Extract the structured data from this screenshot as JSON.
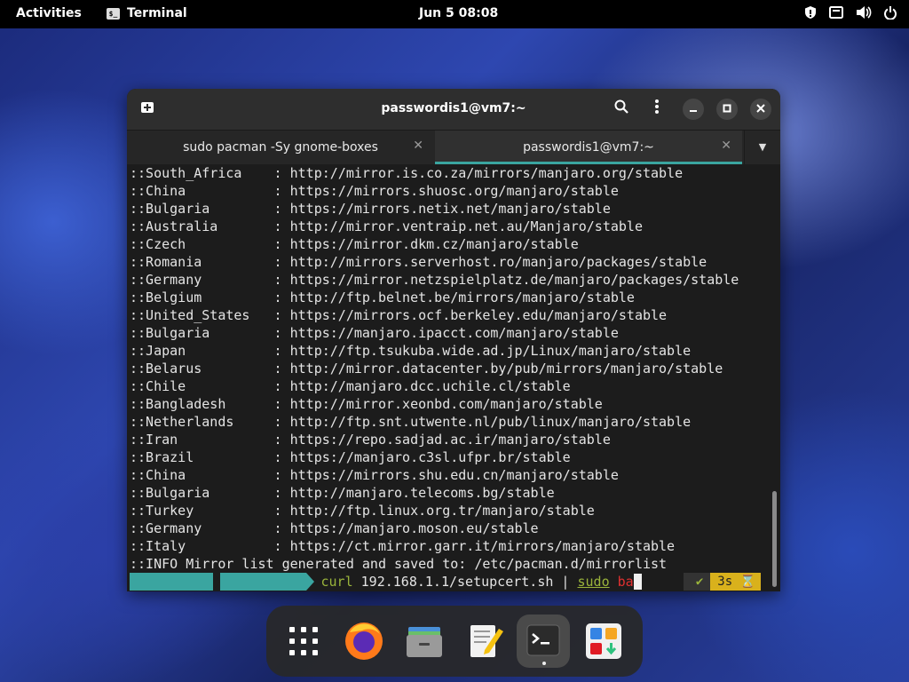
{
  "topbar": {
    "activities": "Activities",
    "app_name": "Terminal",
    "clock": "Jun 5  08:08"
  },
  "window": {
    "title": "passwordis1@vm7:~",
    "tabs": [
      {
        "label": "sudo pacman -Sy gnome-boxes"
      },
      {
        "label": "passwordis1@vm7:~"
      }
    ]
  },
  "terminal": {
    "lines": [
      "::South_Africa    : http://mirror.is.co.za/mirrors/manjaro.org/stable",
      "::China           : https://mirrors.shuosc.org/manjaro/stable",
      "::Bulgaria        : https://mirrors.netix.net/manjaro/stable",
      "::Australia       : http://mirror.ventraip.net.au/Manjaro/stable",
      "::Czech           : https://mirror.dkm.cz/manjaro/stable",
      "::Romania         : http://mirrors.serverhost.ro/manjaro/packages/stable",
      "::Germany         : https://mirror.netzspielplatz.de/manjaro/packages/stable",
      "::Belgium         : http://ftp.belnet.be/mirrors/manjaro/stable",
      "::United_States   : https://mirrors.ocf.berkeley.edu/manjaro/stable",
      "::Bulgaria        : https://manjaro.ipacct.com/manjaro/stable",
      "::Japan           : http://ftp.tsukuba.wide.ad.jp/Linux/manjaro/stable",
      "::Belarus         : http://mirror.datacenter.by/pub/mirrors/manjaro/stable",
      "::Chile           : http://manjaro.dcc.uchile.cl/stable",
      "::Bangladesh      : http://mirror.xeonbd.com/manjaro/stable",
      "::Netherlands     : http://ftp.snt.utwente.nl/pub/linux/manjaro/stable",
      "::Iran            : https://repo.sadjad.ac.ir/manjaro/stable",
      "::Brazil          : https://manjaro.c3sl.ufpr.br/stable",
      "::China           : https://mirrors.shu.edu.cn/manjaro/stable",
      "::Bulgaria        : http://manjaro.telecoms.bg/stable",
      "::Turkey          : http://ftp.linux.org.tr/manjaro/stable",
      "::Germany         : https://manjaro.moson.eu/stable",
      "::Italy           : https://ct.mirror.garr.it/mirrors/manjaro/stable",
      "::INFO Mirror list generated and saved to: /etc/pacman.d/mirrorlist"
    ],
    "prompt": {
      "dir": "~",
      "cmd_curl": "curl",
      "cmd_args": " 192.168.1.1/setupcert.sh | ",
      "cmd_sudo": "sudo",
      "cmd_partial": " ba",
      "status_ok": "✔",
      "elapsed": "3s"
    }
  },
  "dock": {
    "apps": [
      {
        "name": "app-grid-icon"
      },
      {
        "name": "firefox-icon"
      },
      {
        "name": "files-icon"
      },
      {
        "name": "text-editor-icon"
      },
      {
        "name": "terminal-icon"
      },
      {
        "name": "software-icon"
      }
    ]
  },
  "colors": {
    "accent": "#3aa5a0",
    "prompt_time": "#d9b11c",
    "command": "#9ab43b",
    "error": "#e03030"
  }
}
